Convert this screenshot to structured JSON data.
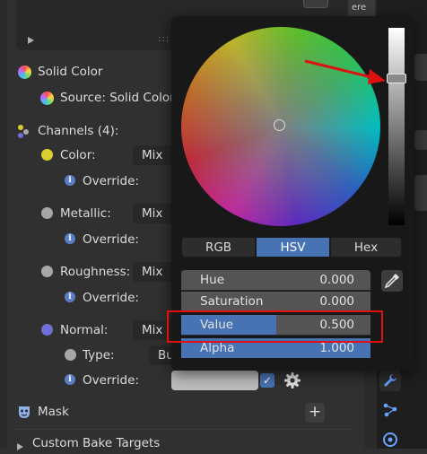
{
  "panel": {
    "top_dots": ":::",
    "solid_color_label": "Solid Color",
    "source_label": "Source: Solid Color",
    "channels_label": "Channels (4):",
    "channels": [
      {
        "label": "Color:",
        "mode": "Mix",
        "socket_color": "#d8cf2e",
        "override_label": "Override:"
      },
      {
        "label": "Metallic:",
        "mode": "Mix",
        "socket_color": "#a7a7a7",
        "override_label": "Override:"
      },
      {
        "label": "Roughness:",
        "mode": "Mix",
        "socket_color": "#a7a7a7",
        "override_label": "Override:"
      },
      {
        "label": "Normal:",
        "mode": "Mix",
        "socket_color": "#6f6fd8",
        "type_label": "Type:",
        "type_value": "Bu",
        "override_label": "Override:"
      }
    ],
    "mask_label": "Mask",
    "custom_bake_label": "Custom Bake Targets",
    "plus_label": "+",
    "check_glyph": "✓"
  },
  "toolbar": {
    "tab_label": "ere",
    "icons": [
      "wrench-icon",
      "node-icon",
      "object-data-icon",
      "particles-icon"
    ]
  },
  "picker": {
    "modes": [
      "RGB",
      "HSV",
      "Hex"
    ],
    "active_mode": "HSV",
    "fields": [
      {
        "name": "Hue",
        "value": "0.000",
        "fraction": 0.0
      },
      {
        "name": "Saturation",
        "value": "0.000",
        "fraction": 0.0
      },
      {
        "name": "Value",
        "value": "0.500",
        "fraction": 0.5
      },
      {
        "name": "Alpha",
        "value": "1.000",
        "fraction": 1.0
      }
    ]
  },
  "colors": {
    "accent": "#4772b3",
    "annotation_red": "#e01010"
  }
}
